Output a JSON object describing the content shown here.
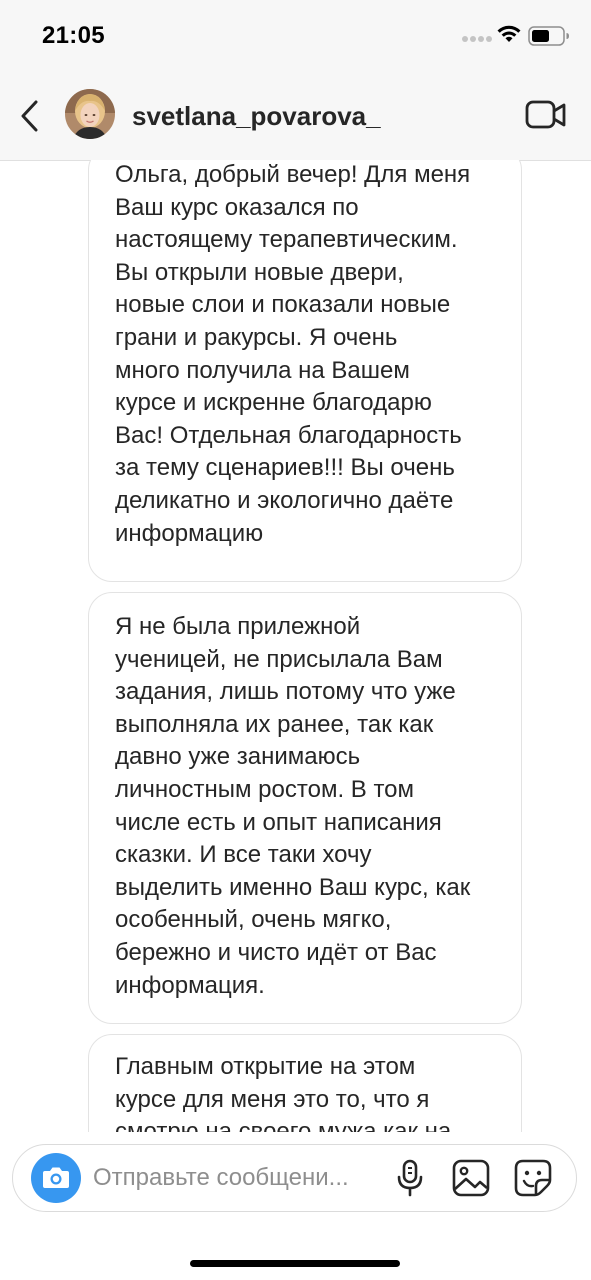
{
  "status_bar": {
    "time": "21:05"
  },
  "header": {
    "username": "svetlana_povarova_",
    "icons": [
      "back-arrow-icon",
      "avatar",
      "video-call-icon"
    ]
  },
  "messages": [
    {
      "text": "Ольга, добрый вечер! Для меня\nВаш курс оказался по\nнастоящему терапевтическим.\nВы открыли новые двери,\nновые слои и показали новые\nграни и ракурсы. Я очень\nмного получила на Вашем\nкурсе и искренне благодарю\nВас! Отдельная благодарность\nза тему сценариев!!! Вы очень\nделикатно и экологично даёте\nинформацию"
    },
    {
      "text": "Я не была прилежной\nученицей, не присылала Вам\nзадания, лишь потому что уже\nвыполняла их ранее, так как\nдавно уже занимаюсь\nличностным ростом. В том\nчисле есть и опыт написания\nсказки. И все таки хочу\nвыделить именно Ваш курс, как\nособенный, очень мягко,\nбережно и чисто идёт от Вас\nинформация."
    },
    {
      "text": "Главным открытие на этом\nкурсе для меня это  то, что я\nсмотрю на своего мужа как на"
    }
  ],
  "composer": {
    "placeholder": "Отправьте сообщени...",
    "icons": [
      "camera-icon",
      "microphone-icon",
      "gallery-icon",
      "sticker-icon"
    ]
  },
  "colors": {
    "camera_button": "#3797f0",
    "bubble_border": "#e3e3e3",
    "header_bg": "#f7f7f7"
  }
}
